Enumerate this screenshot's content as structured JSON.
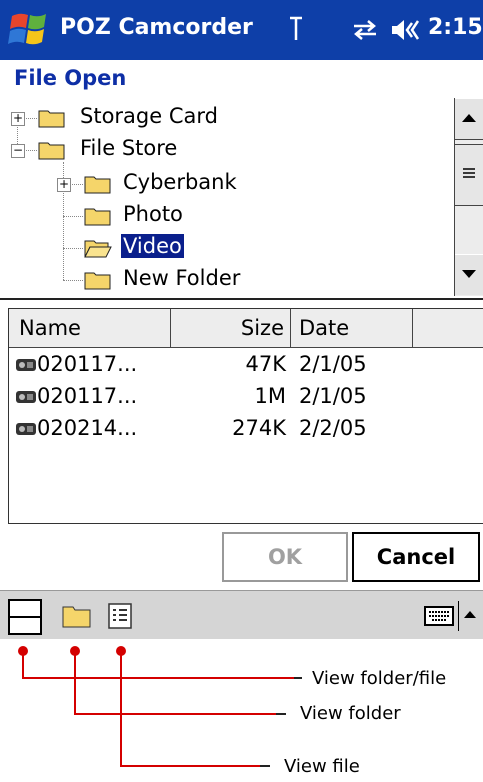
{
  "titlebar": {
    "app_title": "POZ Camcorder",
    "time": "2:15",
    "icons": [
      "windows-logo-icon",
      "signal-icon",
      "sync-icon",
      "volume-icon"
    ]
  },
  "dialog": {
    "title": "File Open"
  },
  "tree": {
    "items": [
      {
        "label": "Storage Card",
        "expander": "+",
        "level": 0
      },
      {
        "label": "File Store",
        "expander": "−",
        "level": 0
      },
      {
        "label": "Cyberbank",
        "expander": "+",
        "level": 1
      },
      {
        "label": "Photo",
        "expander": "",
        "level": 1
      },
      {
        "label": "Video",
        "expander": "",
        "level": 1,
        "selected": true
      },
      {
        "label": "New Folder",
        "expander": "",
        "level": 1
      }
    ]
  },
  "list": {
    "columns": [
      "Name",
      "Size",
      "Date"
    ],
    "rows": [
      {
        "name": "020117...",
        "size": "47K",
        "date": "2/1/05"
      },
      {
        "name": "020117...",
        "size": "1M",
        "date": "2/1/05"
      },
      {
        "name": "020214...",
        "size": "274K",
        "date": "2/2/05"
      }
    ]
  },
  "buttons": {
    "ok": "OK",
    "cancel": "Cancel"
  },
  "menubar": {
    "icons": [
      "view-folder-file-icon",
      "view-folder-icon",
      "view-file-icon",
      "keyboard-icon",
      "arrow-up-icon"
    ]
  },
  "annotations": {
    "view_folder_file": "View folder/file",
    "view_folder": "View folder",
    "view_file": "View file"
  },
  "colors": {
    "titlebar": "#0e3fa8",
    "dialog_title": "#0e2fa6",
    "selection": "#0a1f8c",
    "annotation_line": "#d40000",
    "folder": "#f5d56a"
  }
}
